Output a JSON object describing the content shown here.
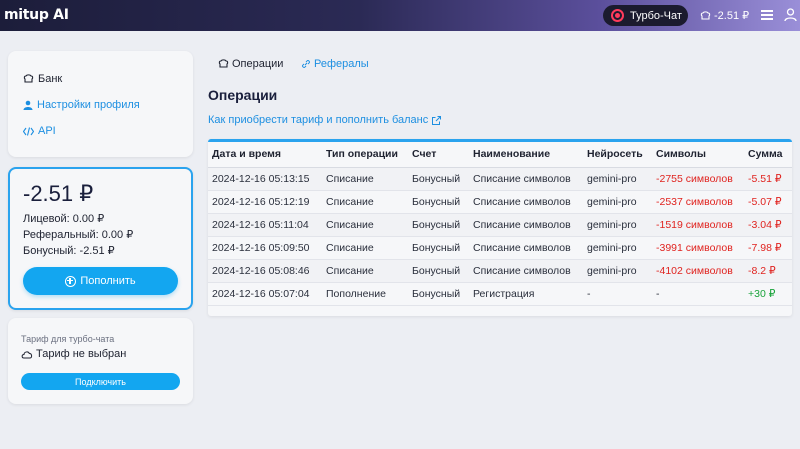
{
  "header": {
    "logo": "mitup",
    "logo_ai": "AI",
    "turbo_label": "Турбо-Чат",
    "balance": "-2.51 ₽"
  },
  "sidebar": {
    "items": [
      {
        "label": "Банк"
      },
      {
        "label": "Настройки профиля"
      },
      {
        "label": "API"
      }
    ]
  },
  "balance_card": {
    "total": "-2.51 ₽",
    "personal": "Лицевой: 0.00 ₽",
    "referral": "Реферальный: 0.00 ₽",
    "bonus": "Бонусный: -2.51 ₽",
    "topup_label": "Пополнить"
  },
  "tariff_card": {
    "caption": "Тариф для турбо-чата",
    "status": "Тариф не выбран",
    "connect_label": "Подключить"
  },
  "tabs": [
    {
      "label": "Операции"
    },
    {
      "label": "Рефералы"
    }
  ],
  "main": {
    "title": "Операции",
    "help_link": "Как приобрести тариф и пополнить баланс"
  },
  "table": {
    "columns": [
      "Дата и время",
      "Тип операции",
      "Счет",
      "Наименование",
      "Нейросеть",
      "Символы",
      "Сумма"
    ],
    "rows": [
      {
        "datetime": "2024-12-16 05:13:15",
        "type": "Списание",
        "account": "Бонусный",
        "name": "Списание символов",
        "model": "gemini-pro",
        "symbols": "-2755 символов",
        "amount": "-5.51 ₽",
        "sign": "neg"
      },
      {
        "datetime": "2024-12-16 05:12:19",
        "type": "Списание",
        "account": "Бонусный",
        "name": "Списание символов",
        "model": "gemini-pro",
        "symbols": "-2537 символов",
        "amount": "-5.07 ₽",
        "sign": "neg"
      },
      {
        "datetime": "2024-12-16 05:11:04",
        "type": "Списание",
        "account": "Бонусный",
        "name": "Списание символов",
        "model": "gemini-pro",
        "symbols": "-1519 символов",
        "amount": "-3.04 ₽",
        "sign": "neg"
      },
      {
        "datetime": "2024-12-16 05:09:50",
        "type": "Списание",
        "account": "Бонусный",
        "name": "Списание символов",
        "model": "gemini-pro",
        "symbols": "-3991 символов",
        "amount": "-7.98 ₽",
        "sign": "neg"
      },
      {
        "datetime": "2024-12-16 05:08:46",
        "type": "Списание",
        "account": "Бонусный",
        "name": "Списание символов",
        "model": "gemini-pro",
        "symbols": "-4102 символов",
        "amount": "-8.2 ₽",
        "sign": "neg"
      },
      {
        "datetime": "2024-12-16 05:07:04",
        "type": "Пополнение",
        "account": "Бонусный",
        "name": "Регистрация",
        "model": "-",
        "symbols": "-",
        "amount": "+30 ₽",
        "sign": "pos"
      }
    ]
  },
  "colors": {
    "accent": "#13a6f0",
    "link": "#1d8fe1",
    "negative": "#e0231f",
    "positive": "#1aa33b"
  }
}
